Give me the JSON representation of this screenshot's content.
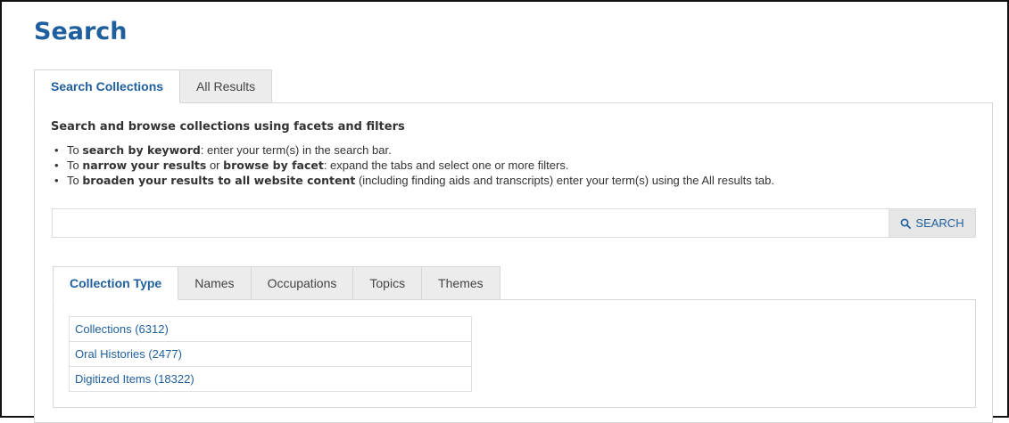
{
  "page_title": "Search",
  "main_tabs": [
    {
      "label": "Search Collections",
      "active": true
    },
    {
      "label": "All Results",
      "active": false
    }
  ],
  "intro": {
    "heading": "Search and browse collections using facets and filters",
    "bullets": [
      {
        "prefix": "To ",
        "bold": "search by keyword",
        "suffix": ": enter your term(s) in the search bar."
      },
      {
        "prefix": "To ",
        "bold": "narrow your results",
        "mid": " or ",
        "bold2": "browse by facet",
        "suffix": ": expand the tabs and select one or more filters."
      },
      {
        "prefix": "To ",
        "bold": "broaden your results to all website content",
        "suffix": " (including finding aids and transcripts) enter your term(s) using the All results tab."
      }
    ]
  },
  "search": {
    "value": "",
    "placeholder": "",
    "button_label": "SEARCH",
    "button_icon": "search-icon"
  },
  "facet_tabs": [
    {
      "label": "Collection Type",
      "active": true
    },
    {
      "label": "Names",
      "active": false
    },
    {
      "label": "Occupations",
      "active": false
    },
    {
      "label": "Topics",
      "active": false
    },
    {
      "label": "Themes",
      "active": false
    }
  ],
  "facet_items": [
    {
      "label": "Collections (6312)"
    },
    {
      "label": "Oral Histories (2477)"
    },
    {
      "label": "Digitized Items (18322)"
    }
  ],
  "colors": {
    "accent": "#1f5f9e",
    "tab_inactive_bg": "#ececec",
    "button_bg": "#e6e6e6"
  }
}
